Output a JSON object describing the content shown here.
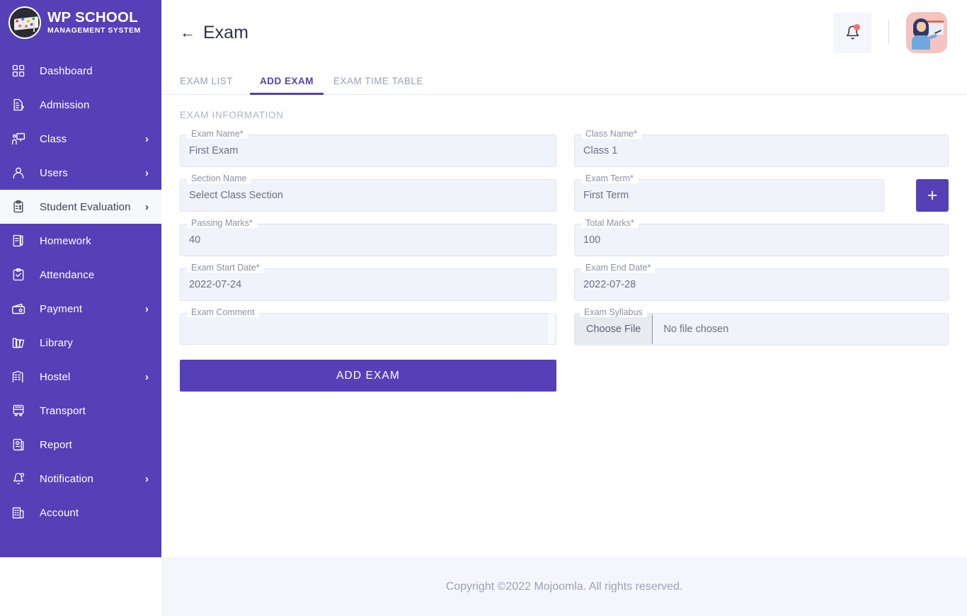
{
  "brand": {
    "title": "WP SCHOOL",
    "subtitle": "MANAGEMENT SYSTEM",
    "logo_icon": "graduation-cap-logo"
  },
  "colors": {
    "sidebar": "#5540B7",
    "accent": "#5540B7",
    "field_bg": "#F0F3F9",
    "footer_bg": "#F4F6FB",
    "avatar_bg": "#F4C4C0",
    "notification_dot": "#FF6B6B"
  },
  "sidebar": {
    "items": [
      {
        "label": "Dashboard",
        "icon": "grid-icon",
        "chevron": "",
        "active": false
      },
      {
        "label": "Admission",
        "icon": "document-pen-icon",
        "chevron": "",
        "active": false
      },
      {
        "label": "Class",
        "icon": "classroom-icon",
        "chevron": "›",
        "active": false
      },
      {
        "label": "Users",
        "icon": "user-icon",
        "chevron": "›",
        "active": false
      },
      {
        "label": "Student Evaluation",
        "icon": "clipboard-check-icon",
        "chevron": "›",
        "active": true
      },
      {
        "label": "Homework",
        "icon": "book-pencil-icon",
        "chevron": "",
        "active": false
      },
      {
        "label": "Attendance",
        "icon": "clipboard-tick-icon",
        "chevron": "",
        "active": false
      },
      {
        "label": "Payment",
        "icon": "wallet-icon",
        "chevron": "›",
        "active": false
      },
      {
        "label": "Library",
        "icon": "books-icon",
        "chevron": "",
        "active": false
      },
      {
        "label": "Hostel",
        "icon": "building-icon",
        "chevron": "›",
        "active": false
      },
      {
        "label": "Transport",
        "icon": "bus-icon",
        "chevron": "",
        "active": false
      },
      {
        "label": "Report",
        "icon": "report-icon",
        "chevron": "",
        "active": false
      },
      {
        "label": "Notification",
        "icon": "bell-icon",
        "chevron": "›",
        "active": false
      },
      {
        "label": "Account",
        "icon": "account-building-icon",
        "chevron": "",
        "active": false
      }
    ]
  },
  "topbar": {
    "back_arrow": "←",
    "title": "Exam",
    "bell_icon": "bell-icon",
    "avatar_icon": "teacher-avatar"
  },
  "tabs": [
    {
      "label": "EXAM LIST",
      "active": false
    },
    {
      "label": "ADD EXAM",
      "active": true
    },
    {
      "label": "EXAM TIME TABLE",
      "active": false
    }
  ],
  "form": {
    "section_title": "EXAM INFORMATION",
    "exam_name": {
      "label": "Exam Name*",
      "value": "First Exam"
    },
    "class_name": {
      "label": "Class Name*",
      "value": "Class 1"
    },
    "section_name": {
      "label": "Section Name",
      "value": "Select Class Section"
    },
    "exam_term": {
      "label": "Exam Term*",
      "value": "First Term"
    },
    "add_term_button": "+",
    "passing_marks": {
      "label": "Passing Marks*",
      "value": "40"
    },
    "total_marks": {
      "label": "Total Marks*",
      "value": "100"
    },
    "start_date": {
      "label": "Exam Start Date*",
      "value": "2022-07-24"
    },
    "end_date": {
      "label": "Exam End Date*",
      "value": "2022-07-28"
    },
    "comment": {
      "label": "Exam Comment",
      "value": ""
    },
    "syllabus": {
      "label": "Exam Syllabus",
      "choose_file": "Choose File",
      "file_status": "No file chosen"
    },
    "submit_label": "ADD EXAM"
  },
  "footer": {
    "text": "Copyright ©2022 Mojoomla. All rights reserved."
  }
}
